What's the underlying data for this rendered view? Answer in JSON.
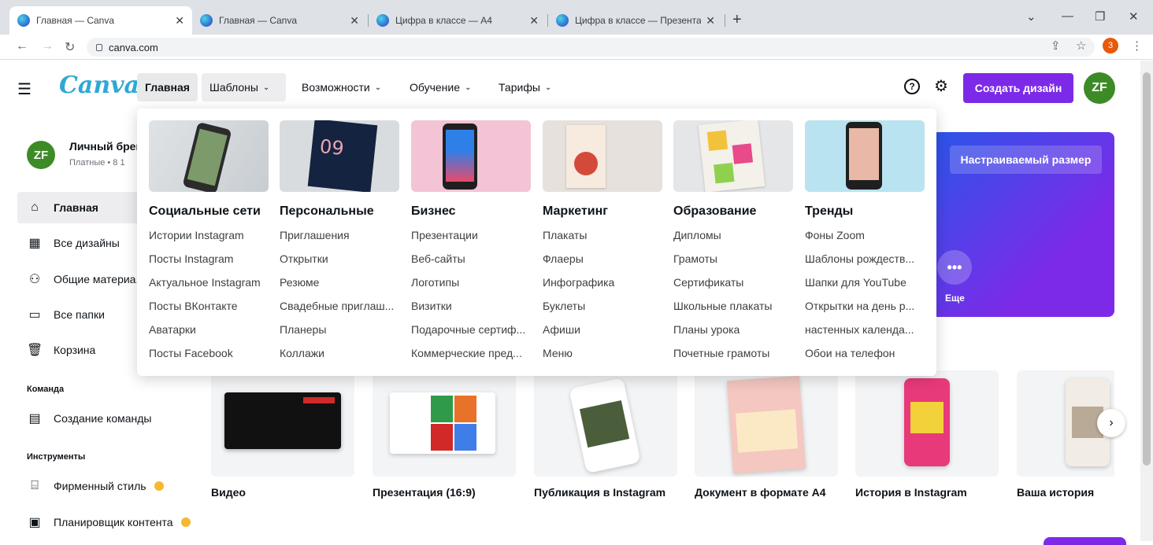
{
  "browser": {
    "tabs": [
      {
        "title": "Главная — Canva",
        "active": true
      },
      {
        "title": "Главная — Canva",
        "active": false
      },
      {
        "title": "Цифра в классе — А4",
        "active": false
      },
      {
        "title": "Цифра в классе — Презентации",
        "active": false
      }
    ],
    "url": "canva.com",
    "badge": "3"
  },
  "header": {
    "logo": "Canva",
    "nav": [
      {
        "label": "Главная"
      },
      {
        "label": "Шаблоны"
      },
      {
        "label": "Возможности"
      },
      {
        "label": "Обучение"
      },
      {
        "label": "Тарифы"
      }
    ],
    "help": "?",
    "create": "Создать дизайн",
    "avatar": "ZF"
  },
  "sidebar": {
    "brand_avatar": "ZF",
    "brand_name": "Личный брен",
    "brand_sub": "Платные • 8 1",
    "items": [
      {
        "label": "Главная"
      },
      {
        "label": "Все дизайны"
      },
      {
        "label": "Общие материа..."
      },
      {
        "label": "Все папки"
      },
      {
        "label": "Корзина"
      }
    ],
    "team_heading": "Команда",
    "team_item": "Создание команды",
    "tools_heading": "Инструменты",
    "tools": [
      {
        "label": "Фирменный стиль"
      },
      {
        "label": "Планировщик контента"
      }
    ]
  },
  "hero": {
    "custom_size": "Настраиваемый размер",
    "more_label": "Еще",
    "more_icon": "•••"
  },
  "design_cards": [
    {
      "label": "Видео"
    },
    {
      "label": "Презентация (16:9)"
    },
    {
      "label": "Публикация в Instagram"
    },
    {
      "label": "Документ в формате А4"
    },
    {
      "label": "История в Instagram"
    },
    {
      "label": "Ваша история"
    }
  ],
  "dropdown": {
    "columns": [
      {
        "title": "Социальные сети",
        "links": [
          "Истории Instagram",
          "Посты Instagram",
          "Актуальное Instagram",
          "Посты ВКонтакте",
          "Аватарки",
          "Посты Facebook"
        ]
      },
      {
        "title": "Персональные",
        "links": [
          "Приглашения",
          "Открытки",
          "Резюме",
          "Свадебные приглаш...",
          "Планеры",
          "Коллажи"
        ]
      },
      {
        "title": "Бизнес",
        "links": [
          "Презентации",
          "Веб-сайты",
          "Логотипы",
          "Визитки",
          "Подарочные сертиф...",
          "Коммерческие пред..."
        ]
      },
      {
        "title": "Маркетинг",
        "links": [
          "Плакаты",
          "Флаеры",
          "Инфографика",
          "Буклеты",
          "Афиши",
          "Меню"
        ]
      },
      {
        "title": "Образование",
        "links": [
          "Дипломы",
          "Грамоты",
          "Сертификаты",
          "Школьные плакаты",
          "Планы урока",
          "Почетные грамоты"
        ]
      },
      {
        "title": "Тренды",
        "links": [
          "Фоны Zoom",
          "Шаблоны рождеств...",
          "Шапки для YouTube",
          "Открытки на день р...",
          "настенных календа...",
          "Обои на телефон"
        ]
      }
    ]
  },
  "colors": {
    "accent": "#7d2ae8",
    "avatar": "#3d8b27",
    "logo": "#2fa8d4"
  }
}
